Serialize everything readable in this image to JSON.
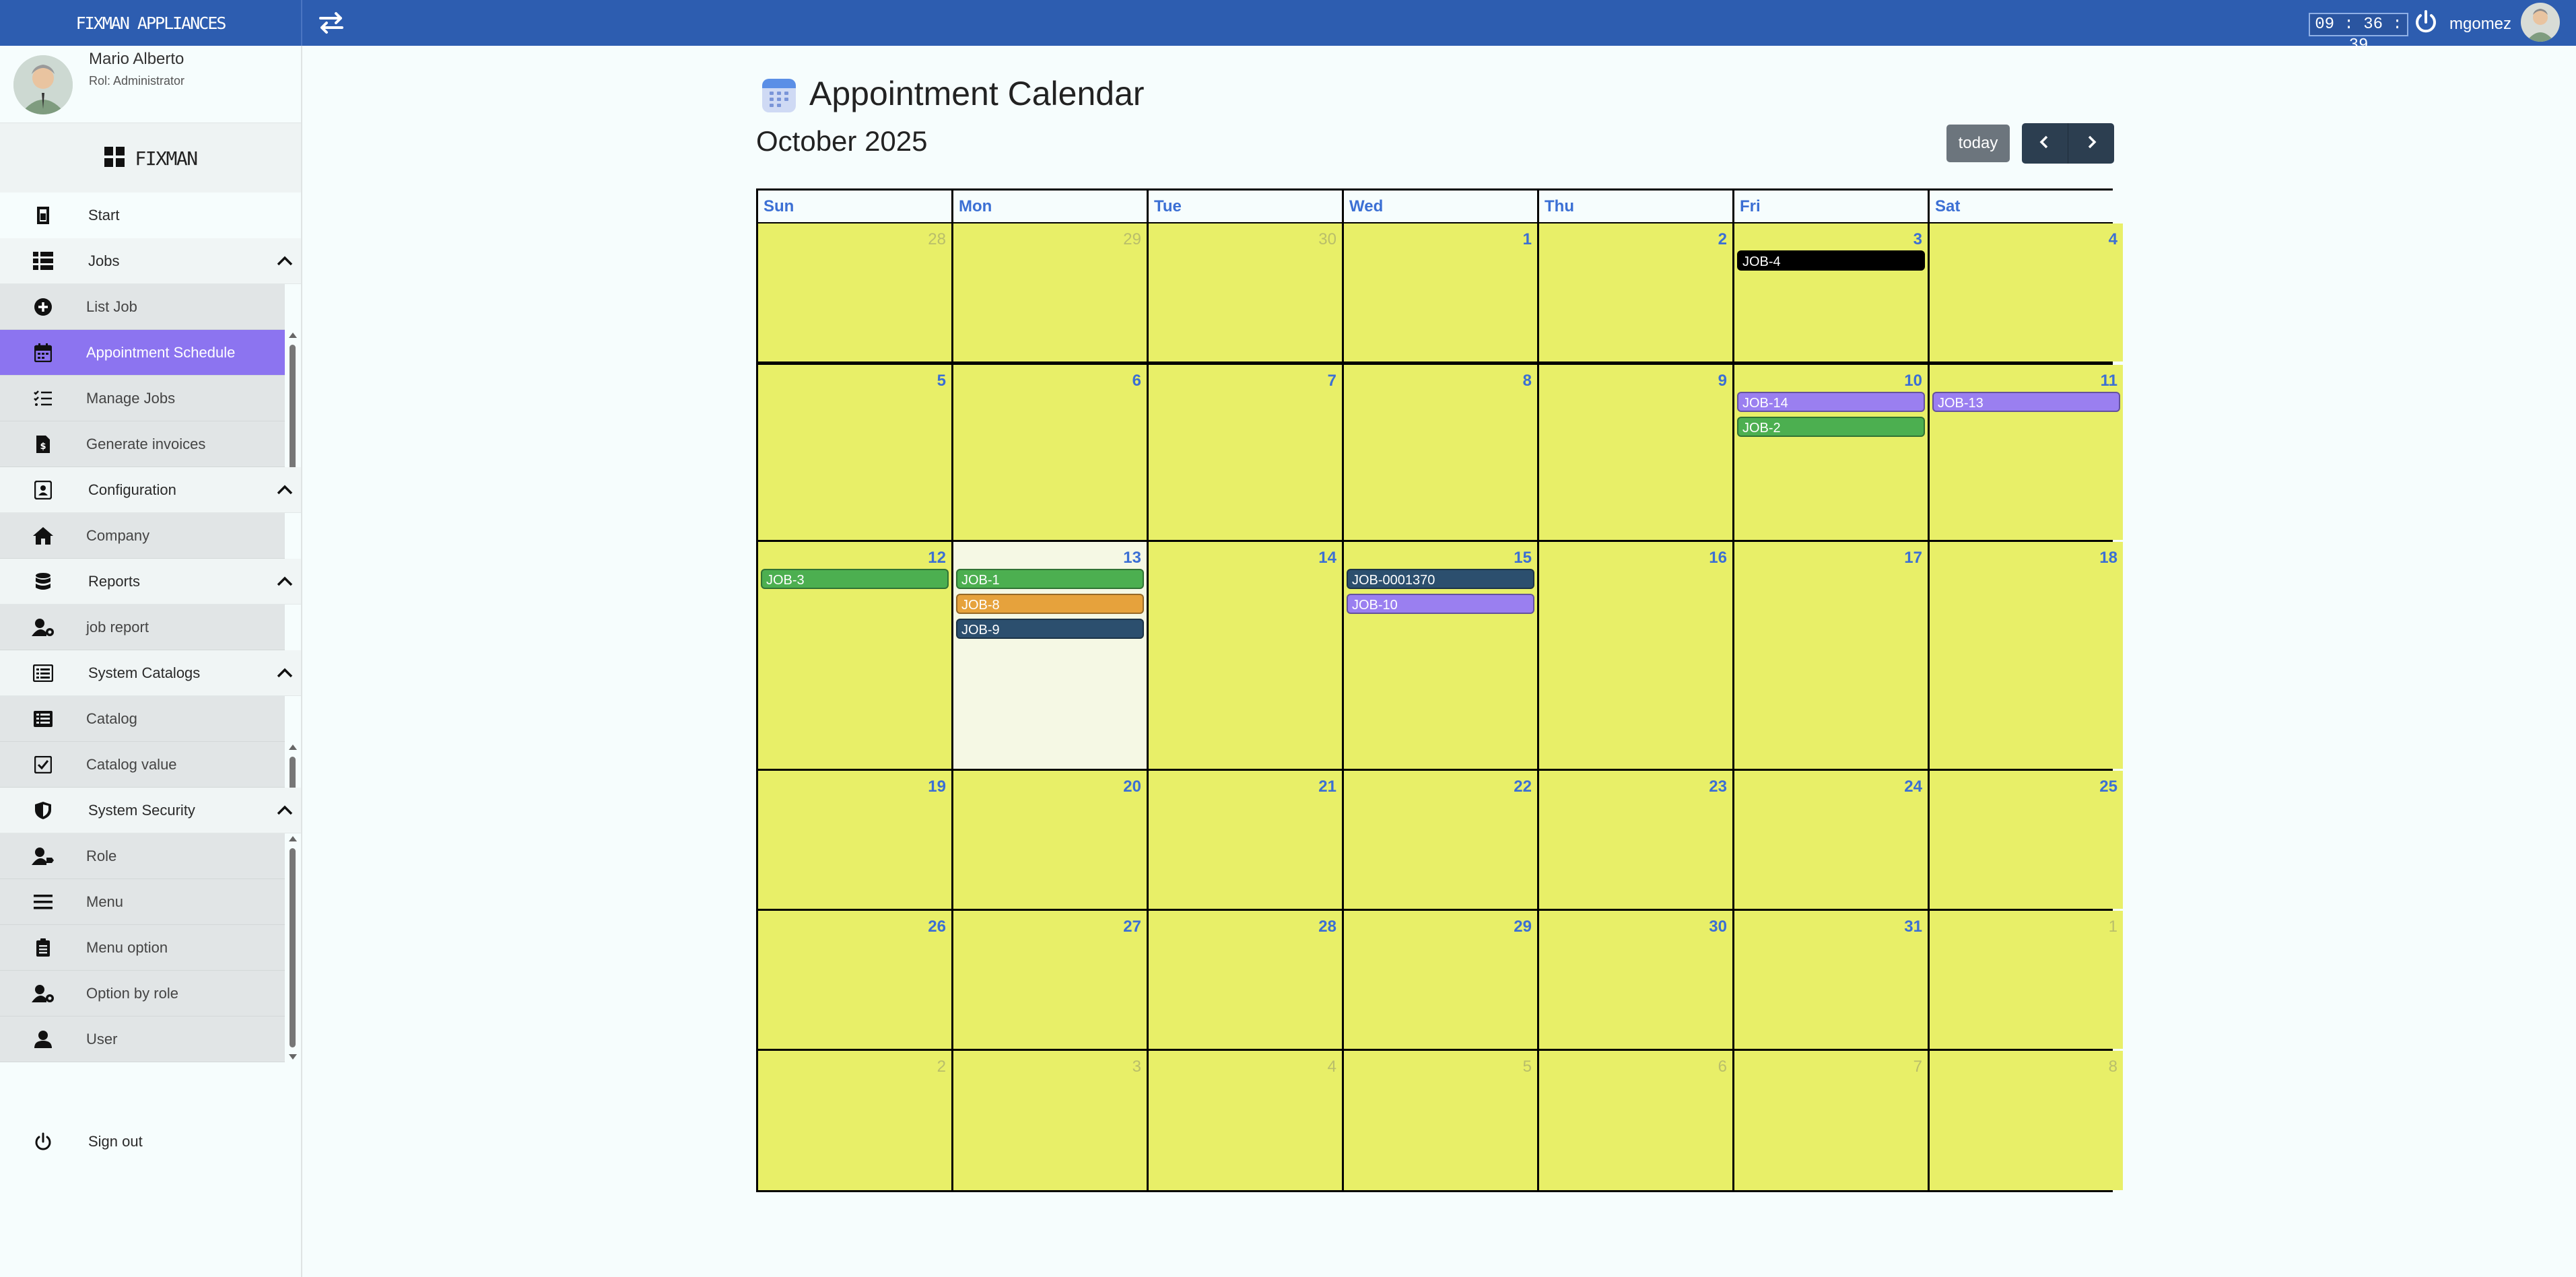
{
  "app": {
    "brand": "FIXMAN APPLIANCES"
  },
  "topbar": {
    "clock": "09 : 36 : 39",
    "username": "mgomez"
  },
  "profile": {
    "name": "Mario Alberto",
    "role": "Rol: Administrator"
  },
  "sidebar": {
    "header": "FIXMAN",
    "start": "Start",
    "jobs": {
      "label": "Jobs",
      "items": [
        "List Job",
        "Appointment Schedule",
        "Manage Jobs",
        "Generate invoices"
      ]
    },
    "configuration": {
      "label": "Configuration",
      "items": [
        "Company"
      ]
    },
    "reports": {
      "label": "Reports",
      "items": [
        "job report"
      ]
    },
    "catalogs": {
      "label": "System Catalogs",
      "items": [
        "Catalog",
        "Catalog value"
      ]
    },
    "security": {
      "label": "System Security",
      "items": [
        "Role",
        "Menu",
        "Menu option",
        "Option by role",
        "User"
      ]
    },
    "signout": "Sign out"
  },
  "main": {
    "title": "Appointment Calendar",
    "month": "October 2025",
    "today_label": "today"
  },
  "calendar": {
    "weekdays": [
      "Sun",
      "Mon",
      "Tue",
      "Wed",
      "Thu",
      "Fri",
      "Sat"
    ],
    "weeks": [
      [
        "28",
        "29",
        "30",
        "1",
        "2",
        "3",
        "4"
      ],
      [
        "5",
        "6",
        "7",
        "8",
        "9",
        "10",
        "11"
      ],
      [
        "12",
        "13",
        "14",
        "15",
        "16",
        "17",
        "18"
      ],
      [
        "19",
        "20",
        "21",
        "22",
        "23",
        "24",
        "25"
      ],
      [
        "26",
        "27",
        "28",
        "29",
        "30",
        "31",
        "1"
      ],
      [
        "2",
        "3",
        "4",
        "5",
        "6",
        "7",
        "8"
      ]
    ],
    "events": [
      {
        "week": 0,
        "day": 5,
        "label": "JOB-4",
        "color": "#000000"
      },
      {
        "week": 1,
        "day": 5,
        "label": "JOB-14",
        "color": "#9a7ff0"
      },
      {
        "week": 1,
        "day": 5,
        "label": "JOB-2",
        "color": "#4caf50"
      },
      {
        "week": 1,
        "day": 6,
        "label": "JOB-13",
        "color": "#9a7ff0"
      },
      {
        "week": 2,
        "day": 0,
        "label": "JOB-3",
        "color": "#4caf50"
      },
      {
        "week": 2,
        "day": 1,
        "label": "JOB-1",
        "color": "#4caf50"
      },
      {
        "week": 2,
        "day": 1,
        "label": "JOB-8",
        "color": "#e6a23c"
      },
      {
        "week": 2,
        "day": 1,
        "label": "JOB-9",
        "color": "#2c4f6e"
      },
      {
        "week": 2,
        "day": 3,
        "label": "JOB-0001370",
        "color": "#2c4f6e"
      },
      {
        "week": 2,
        "day": 3,
        "label": "JOB-10",
        "color": "#9a7ff0"
      }
    ]
  },
  "colors": {
    "topbar": "#2d5db0",
    "active_menu": "#8c74f0",
    "day_cell": "#e8ef68",
    "today_cell": "#f5f8e4",
    "day_number": "#3b6fd4"
  }
}
